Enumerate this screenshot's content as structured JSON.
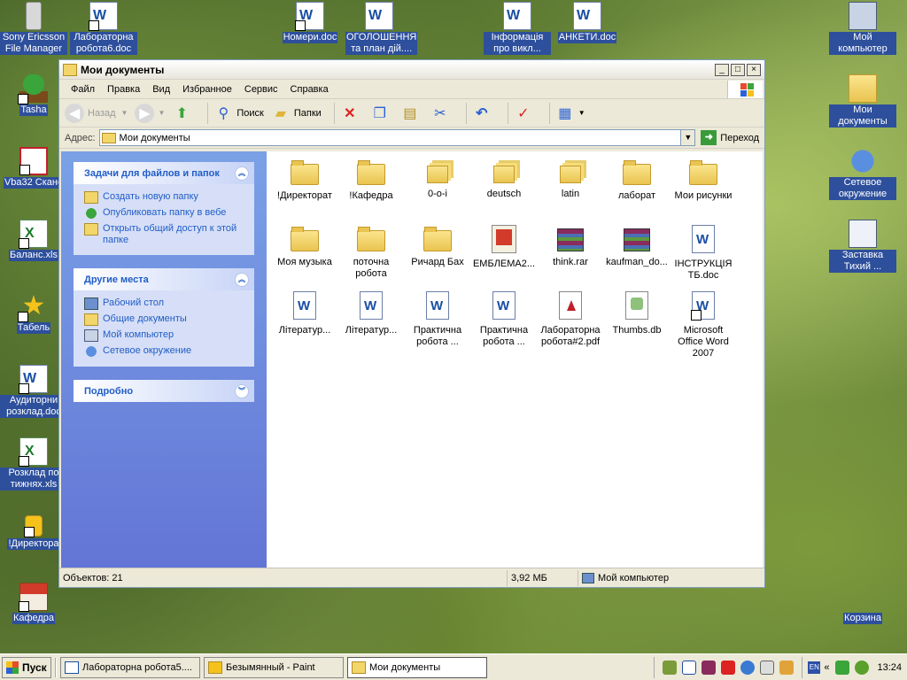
{
  "desktop": {
    "icons": {
      "sony": "Sony Ericsson File Manager",
      "lab6": "Лабораторна робота6.doc",
      "nomery": "Номери.doc",
      "ogolosh": "ОГОЛОШЕННЯ та план дій....",
      "info": "Інформація про викл...",
      "ankety": "АНКЕТИ.doc",
      "mycomp": "Мой компьютер",
      "tasha": "Tasha",
      "mydocs": "Мои документы",
      "vba": "Vba32 Скане",
      "network": "Сетевое окружение",
      "balans": "Баланс.xls",
      "zastavka": "Заставка Тихий ...",
      "tabel": "Табель",
      "auditor": "Аудиторни розклад.doc",
      "rozklad": "Розклад по тижнях.xls",
      "direktor": "!Директора",
      "kafedra": "Кафедра",
      "korzina": "Корзина"
    }
  },
  "window": {
    "title": "Мои документы",
    "buttons": {
      "minimize": "_",
      "maximize": "□",
      "close": "×"
    },
    "menu": [
      "Файл",
      "Правка",
      "Вид",
      "Избранное",
      "Сервис",
      "Справка"
    ],
    "toolbar": {
      "back": "Назад",
      "search": "Поиск",
      "folders": "Папки"
    },
    "address": {
      "label": "Адрес:",
      "value": "Мои документы",
      "go": "Переход"
    },
    "tasks": {
      "files_title": "Задачи для файлов и папок",
      "files_items": [
        "Создать новую папку",
        "Опубликовать папку в вебе",
        "Открыть общий доступ к этой папке"
      ],
      "places_title": "Другие места",
      "places_items": [
        "Рабочий стол",
        "Общие документы",
        "Мой компьютер",
        "Сетевое окружение"
      ],
      "details_title": "Подробно"
    },
    "files": [
      "!Директорат",
      "!Кафедра",
      "0-o-i",
      "deutsch",
      "latin",
      "лаборат",
      "Мои рисунки",
      "Моя музыка",
      "поточна робота",
      "Ричард Бах",
      "ЕМБЛЕМА2...",
      "think.rar",
      "kaufman_do...",
      "ІНСТРУКЦІЯ ТБ.doc",
      "Літератур...",
      "Літератур...",
      "Практична робота ...",
      "Практична робота ...",
      "Лабораторна робота#2.pdf",
      "Thumbs.db",
      "Microsoft Office Word 2007"
    ],
    "status": {
      "objects": "Объектов: 21",
      "size": "3,92 МБ",
      "location": "Мой компьютер"
    }
  },
  "taskbar": {
    "start": "Пуск",
    "tasks": [
      "Лабораторна робота5....",
      "Безымянный - Paint",
      "Мои документы"
    ],
    "lang": "EN",
    "clock": "13:24"
  },
  "colors": {
    "titlebar_text": "#000000",
    "task_link": "#215dc6",
    "icon_label_bg": "#2d4f9c"
  }
}
